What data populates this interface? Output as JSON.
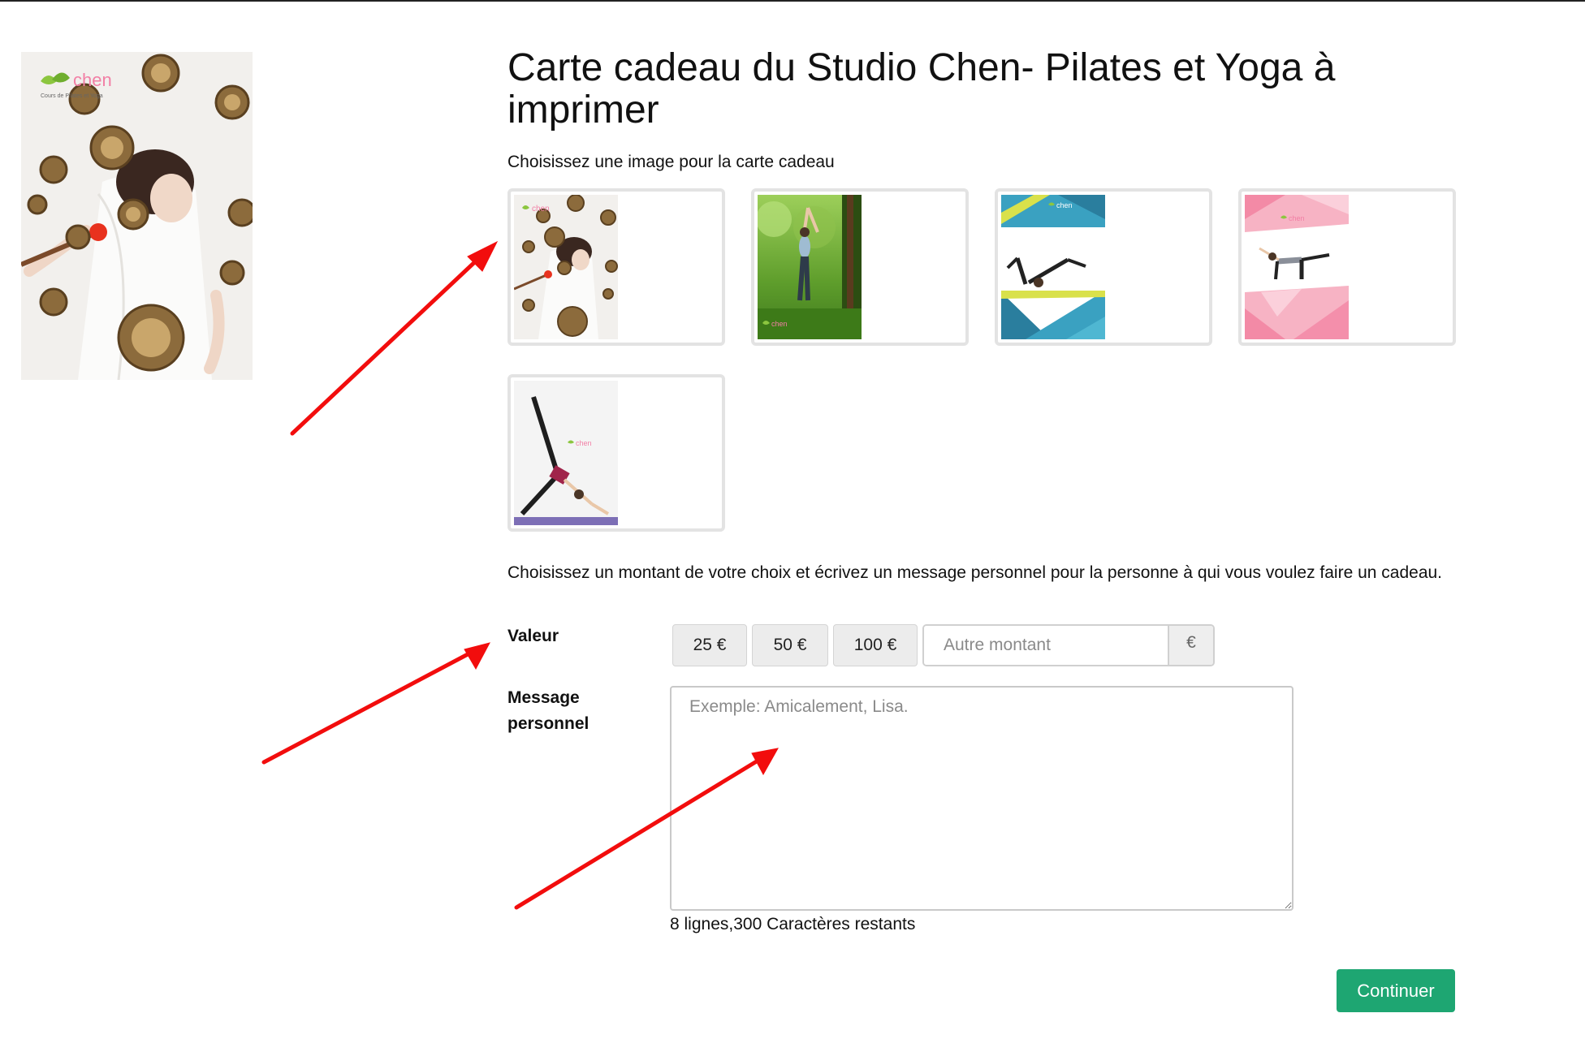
{
  "page": {
    "title": "Carte cadeau du Studio Chen- Pilates et Yoga à imprimer"
  },
  "preview": {
    "logo_text": "chen",
    "logo_subtitle": "Cours de Pilates et Yoga"
  },
  "image_picker": {
    "label": "Choisissez une image pour la carte cadeau",
    "options": [
      {
        "name": "singing-bowls",
        "logo_text": "chen"
      },
      {
        "name": "forest-yoga",
        "logo_text": "chen"
      },
      {
        "name": "blue-geometric-pilates",
        "logo_text": "chen"
      },
      {
        "name": "pink-geometric-pilates",
        "logo_text": "chen"
      },
      {
        "name": "downward-dog-studio",
        "logo_text": "chen"
      }
    ]
  },
  "amount": {
    "intro": "Choisissez un montant de votre choix et écrivez un message personnel pour la personne à qui vous voulez faire un cadeau.",
    "label": "Valeur",
    "presets": [
      "25 €",
      "50 €",
      "100 €"
    ],
    "other_placeholder": "Autre montant",
    "currency_symbol": "€"
  },
  "message": {
    "label": "Message personnel",
    "placeholder": "Exemple: Amicalement, Lisa.",
    "remaining": "8 lignes,300 Caractères restants"
  },
  "actions": {
    "continue_label": "Continuer"
  },
  "colors": {
    "primary_button": "#1ea672",
    "annotation_arrow": "#f20d0d",
    "logo_green": "#8cc63f",
    "logo_pink": "#f27fa5"
  }
}
